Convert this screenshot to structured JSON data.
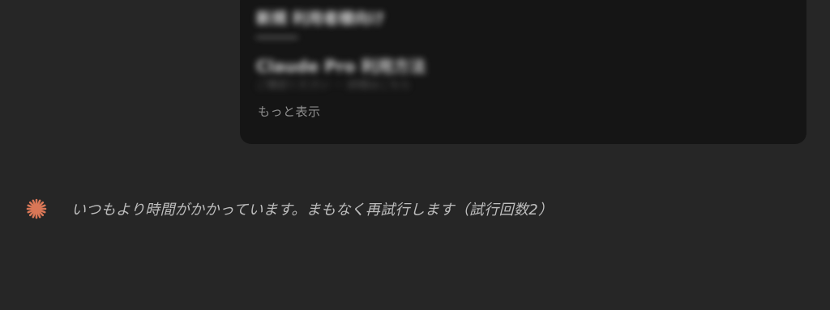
{
  "message_card": {
    "blurred_lines": [
      "新規 利用者様向け",
      "─────",
      "Claude Pro 利用方法",
      "ご確認ください ・ 詳細はこちら"
    ],
    "show_more_label": "もっと表示"
  },
  "status": {
    "icon": "spark-icon",
    "icon_color": "#d97757",
    "text": "いつもより時間がかかっています。まもなく再試行します（試行回数2）"
  },
  "colors": {
    "background": "#262626",
    "card_background": "#151515",
    "muted_text": "#8f8f8f"
  }
}
